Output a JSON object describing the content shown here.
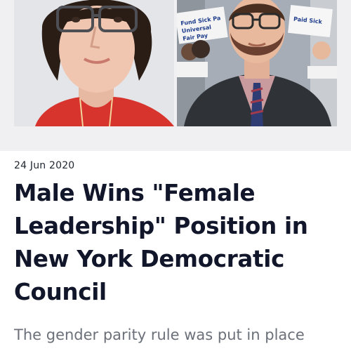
{
  "article": {
    "date": "24 Jun 2020",
    "headline": "Male Wins \"Female Leadership\" Position in New York Democratic Council",
    "lead": "The gender parity rule was put in place"
  },
  "images": {
    "left": {
      "subject": "person-portrait-glasses-red-top"
    },
    "right": {
      "subject": "man-with-beard-at-protest",
      "sign_text_1": "Fund Sick Pa",
      "sign_text_2": "Universal",
      "sign_text_3": "Fair Pay",
      "sign_text_4": "Paid Sick"
    }
  },
  "colors": {
    "headline": "#12162b",
    "body_text": "#6b7079",
    "date_text": "#222831",
    "panel_bg": "#f0f0f3"
  }
}
